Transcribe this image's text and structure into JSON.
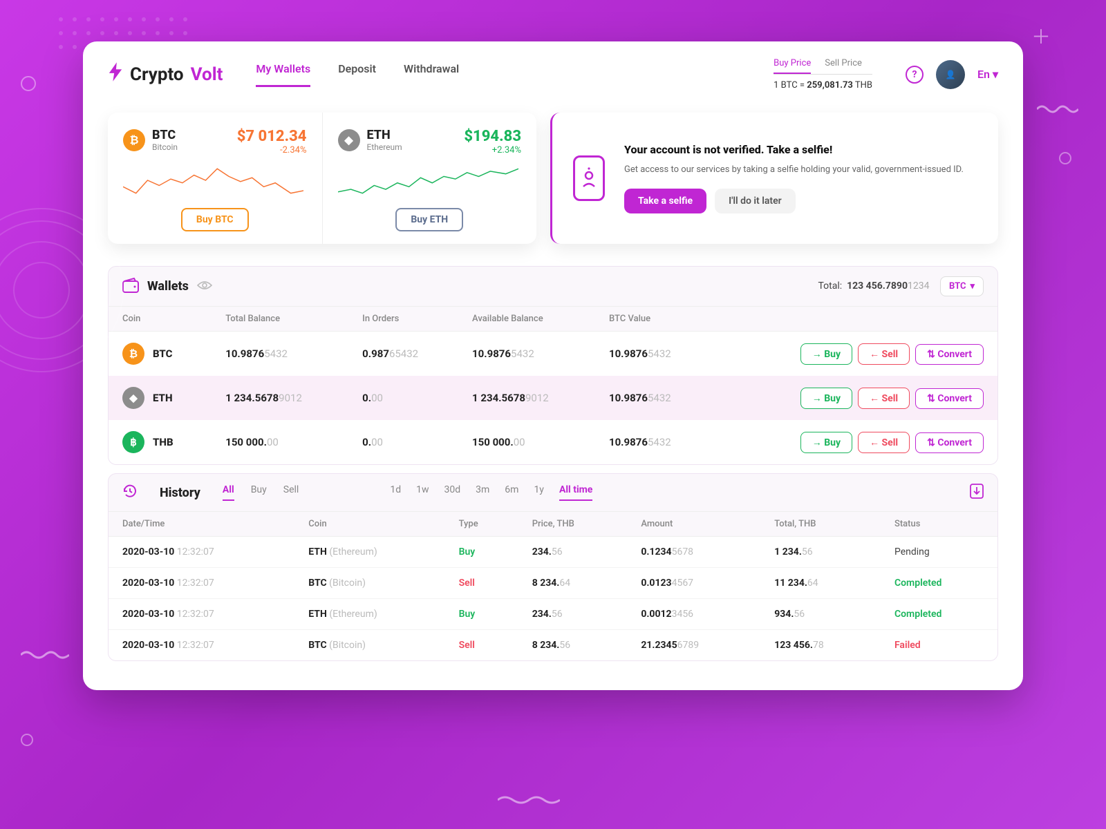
{
  "brand": {
    "name1": "Crypto",
    "name2": "Volt"
  },
  "nav": {
    "wallets": "My Wallets",
    "deposit": "Deposit",
    "withdrawal": "Withdrawal"
  },
  "priceBox": {
    "tabs": {
      "buy": "Buy Price",
      "sell": "Sell Price"
    },
    "linePrefix": "1 BTC = ",
    "value": "259,081.73",
    "suffix": " THB"
  },
  "lang": "En",
  "cards": {
    "btc": {
      "sym": "BTC",
      "name": "Bitcoin",
      "price": "$7 012.34",
      "change": "-2.34%",
      "btn": "Buy BTC"
    },
    "eth": {
      "sym": "ETH",
      "name": "Ethereum",
      "price": "$194.83",
      "change": "+2.34%",
      "btn": "Buy ETH"
    }
  },
  "verify": {
    "title": "Your account is not verified. Take a selfie!",
    "desc": "Get access to our services by taking a selfie holding your valid, government-issued ID.",
    "primary": "Take a selfie",
    "secondary": "I'll do it later"
  },
  "wallets": {
    "title": "Wallets",
    "totalLabel": "Total:",
    "totalMain": "123 456.7890",
    "totalDim": "1234",
    "selector": "BTC",
    "cols": {
      "coin": "Coin",
      "total": "Total Balance",
      "orders": "In Orders",
      "avail": "Available Balance",
      "btcv": "BTC Value"
    },
    "actions": {
      "buy": "Buy",
      "sell": "Sell",
      "conv": "Convert"
    },
    "rows": [
      {
        "icon": "btc",
        "sym": "BTC",
        "totalA": "10.9876",
        "totalB": "5432",
        "ordA": "0.987",
        "ordB": "65432",
        "availA": "10.9876",
        "availB": "5432",
        "btcA": "10.9876",
        "btcB": "5432"
      },
      {
        "icon": "eth",
        "sym": "ETH",
        "totalA": "1 234.5678",
        "totalB": "9012",
        "ordA": "0.",
        "ordB": "00",
        "availA": "1 234.5678",
        "availB": "9012",
        "btcA": "10.9876",
        "btcB": "5432"
      },
      {
        "icon": "thb",
        "sym": "THB",
        "totalA": "150 000.",
        "totalB": "00",
        "ordA": "0.",
        "ordB": "00",
        "availA": "150 000.",
        "availB": "00",
        "btcA": "10.9876",
        "btcB": "5432"
      }
    ]
  },
  "history": {
    "title": "History",
    "filters": {
      "all": "All",
      "buy": "Buy",
      "sell": "Sell"
    },
    "ranges": {
      "d1": "1d",
      "w1": "1w",
      "d30": "30d",
      "m3": "3m",
      "m6": "6m",
      "y1": "1y",
      "all": "All time"
    },
    "cols": {
      "dt": "Date/Time",
      "coin": "Coin",
      "type": "Type",
      "price": "Price, THB",
      "amount": "Amount",
      "total": "Total, THB",
      "status": "Status"
    },
    "rows": [
      {
        "date": "2020-03-10",
        "time": "12:32:07",
        "coinA": "ETH",
        "coinB": " (Ethereum)",
        "type": "Buy",
        "typeCls": "ty-buy",
        "priceA": "234.",
        "priceB": "56",
        "amtA": "0.1234",
        "amtB": "5678",
        "totA": "1 234.",
        "totB": "56",
        "status": "Pending",
        "stCls": "st-pending"
      },
      {
        "date": "2020-03-10",
        "time": "12:32:07",
        "coinA": "BTC",
        "coinB": " (Bitcoin)",
        "type": "Sell",
        "typeCls": "ty-sell",
        "priceA": "8 234.",
        "priceB": "64",
        "amtA": "0.0123",
        "amtB": "4567",
        "totA": "11 234.",
        "totB": "64",
        "status": "Completed",
        "stCls": "st-completed"
      },
      {
        "date": "2020-03-10",
        "time": "12:32:07",
        "coinA": "ETH",
        "coinB": " (Ethereum)",
        "type": "Buy",
        "typeCls": "ty-buy",
        "priceA": "234.",
        "priceB": "56",
        "amtA": "0.0012",
        "amtB": "3456",
        "totA": "934.",
        "totB": "56",
        "status": "Completed",
        "stCls": "st-completed"
      },
      {
        "date": "2020-03-10",
        "time": "12:32:07",
        "coinA": "BTC",
        "coinB": " (Bitcoin)",
        "type": "Sell",
        "typeCls": "ty-sell",
        "priceA": "8 234.",
        "priceB": "56",
        "amtA": "21.2345",
        "amtB": "6789",
        "totA": "123 456.",
        "totB": "78",
        "status": "Failed",
        "stCls": "st-failed"
      }
    ]
  },
  "chart_data": [
    {
      "type": "line",
      "title": "BTC mini sparkline (relative)",
      "x": [
        0,
        1,
        2,
        3,
        4,
        5,
        6,
        7,
        8,
        9,
        10,
        11,
        12,
        13,
        14
      ],
      "values": [
        40,
        20,
        48,
        35,
        55,
        42,
        62,
        50,
        78,
        60,
        46,
        55,
        34,
        42,
        20
      ],
      "ylim": [
        0,
        100
      ]
    },
    {
      "type": "line",
      "title": "ETH mini sparkline (relative)",
      "x": [
        0,
        1,
        2,
        3,
        4,
        5,
        6,
        7,
        8,
        9,
        10,
        11,
        12,
        13,
        14
      ],
      "values": [
        28,
        34,
        22,
        40,
        32,
        46,
        38,
        58,
        48,
        60,
        56,
        70,
        62,
        72,
        78
      ],
      "ylim": [
        0,
        100
      ]
    }
  ]
}
